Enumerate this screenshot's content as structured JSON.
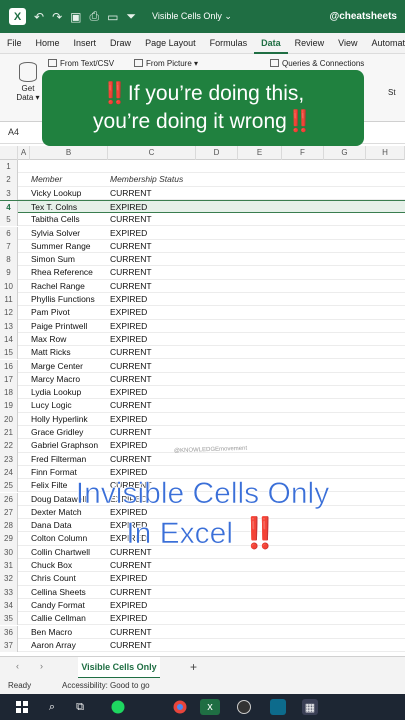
{
  "titlebar": {
    "title": "Visible Cells Only",
    "title_suffix": "⌄",
    "handle": "@cheatsheets",
    "logo": "X",
    "icons": [
      "save-icon",
      "undo-icon",
      "redo-icon",
      "folder-icon",
      "print-icon",
      "filter-icon"
    ]
  },
  "menubar": {
    "items": [
      "File",
      "Home",
      "Insert",
      "Draw",
      "Page Layout",
      "Formulas",
      "Data",
      "Review",
      "View",
      "Automate"
    ],
    "active": "Data"
  },
  "ribbon": {
    "getdata_label": "Get Data ▾",
    "from_text": "From Text/CSV",
    "from_picture": "From Picture ▾",
    "queries": "Queries & Connections",
    "refresh": "St"
  },
  "overlay": {
    "line1": "‼️If you’re doing this,",
    "line2": "you’re doing it wrong‼️"
  },
  "formulabar": {
    "namebox": "A4"
  },
  "columns": [
    "A",
    "B",
    "C",
    "D",
    "E",
    "F",
    "G",
    "H"
  ],
  "sheet": {
    "header": {
      "member": "Member",
      "status": "Membership Status"
    },
    "rows": [
      {
        "num": "1",
        "member": "",
        "status": ""
      },
      {
        "num": "2",
        "member": "Member",
        "status": "Membership Status"
      },
      {
        "num": "3",
        "member": "Vicky Lookup",
        "status": "CURRENT"
      },
      {
        "num": "4",
        "member": "Tex T. Colns",
        "status": "EXPIRED"
      },
      {
        "num": "5",
        "member": "Tabitha Cells",
        "status": "CURRENT"
      },
      {
        "num": "6",
        "member": "Sylvia Solver",
        "status": "EXPIRED"
      },
      {
        "num": "7",
        "member": "Summer Range",
        "status": "CURRENT"
      },
      {
        "num": "8",
        "member": "Simon Sum",
        "status": "CURRENT"
      },
      {
        "num": "9",
        "member": "Rhea Reference",
        "status": "CURRENT"
      },
      {
        "num": "10",
        "member": "Rachel Range",
        "status": "CURRENT"
      },
      {
        "num": "11",
        "member": "Phyllis Functions",
        "status": "EXPIRED"
      },
      {
        "num": "12",
        "member": "Pam Pivot",
        "status": "EXPIRED"
      },
      {
        "num": "13",
        "member": "Paige Printwell",
        "status": "EXPIRED"
      },
      {
        "num": "14",
        "member": "Max Row",
        "status": "EXPIRED"
      },
      {
        "num": "15",
        "member": "Matt Ricks",
        "status": "CURRENT"
      },
      {
        "num": "16",
        "member": "Marge Center",
        "status": "CURRENT"
      },
      {
        "num": "17",
        "member": "Marcy Macro",
        "status": "CURRENT"
      },
      {
        "num": "18",
        "member": "Lydia Lookup",
        "status": "EXPIRED"
      },
      {
        "num": "19",
        "member": "Lucy Logic",
        "status": "CURRENT"
      },
      {
        "num": "20",
        "member": "Holly Hyperlink",
        "status": "EXPIRED"
      },
      {
        "num": "21",
        "member": "Grace Gridley",
        "status": "CURRENT"
      },
      {
        "num": "22",
        "member": "Gabriel Graphson",
        "status": "EXPIRED"
      },
      {
        "num": "23",
        "member": "Fred Filterman",
        "status": "CURRENT"
      },
      {
        "num": "24",
        "member": "Finn Format",
        "status": "EXPIRED"
      },
      {
        "num": "25",
        "member": "Felix Filte",
        "status": "CURRENT"
      },
      {
        "num": "26",
        "member": "Doug Datawell",
        "status": "EXPIRED"
      },
      {
        "num": "27",
        "member": "Dexter Match",
        "status": "EXPIRED"
      },
      {
        "num": "28",
        "member": "Dana Data",
        "status": "EXPIRED"
      },
      {
        "num": "29",
        "member": "Colton Column",
        "status": "EXPIRED"
      },
      {
        "num": "30",
        "member": "Collin Chartwell",
        "status": "CURRENT"
      },
      {
        "num": "31",
        "member": "Chuck Box",
        "status": "CURRENT"
      },
      {
        "num": "32",
        "member": "Chris Count",
        "status": "EXPIRED"
      },
      {
        "num": "33",
        "member": "Cellina Sheets",
        "status": "CURRENT"
      },
      {
        "num": "34",
        "member": "Candy Format",
        "status": "EXPIRED"
      },
      {
        "num": "35",
        "member": "Callie Cellman",
        "status": "EXPIRED"
      },
      {
        "num": "36",
        "member": "Ben Macro",
        "status": "CURRENT"
      },
      {
        "num": "37",
        "member": "Aaron Array",
        "status": "CURRENT"
      }
    ],
    "selected_row": "4"
  },
  "watermark": "@KNOWLEDGEmovement",
  "caption": {
    "line1": "Invisible Cells Only",
    "line2": "In Excel",
    "line2_bang": "‼️"
  },
  "sheettabs": {
    "prev": "‹",
    "next": "›",
    "active_tab": "Visible Cells Only",
    "add": "+"
  },
  "statusbar": {
    "ready": "Ready",
    "accessibility": "Accessibility: Good to go"
  },
  "taskbar": {
    "icons": [
      "windows-icon",
      "search-icon",
      "task-view-icon",
      "spotify-icon",
      "chrome-icon",
      "excel-icon",
      "obs-icon",
      "app-icon",
      "calculator-icon"
    ]
  },
  "colors": {
    "excel_green": "#1f6e43",
    "overlay_green": "#20813f",
    "caption_blue": "#3a6fd8",
    "bang_red": "#e0322c",
    "taskbar": "#1d2633"
  }
}
